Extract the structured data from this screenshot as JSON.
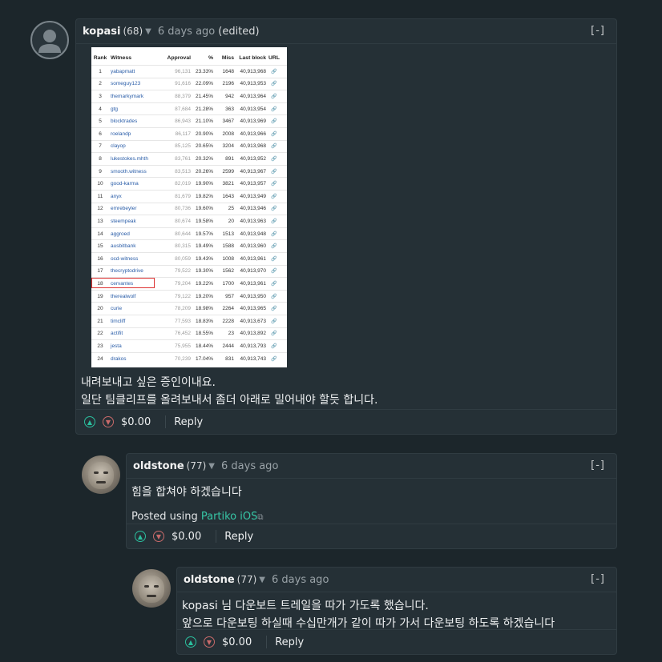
{
  "comments": [
    {
      "author": "kopasi",
      "reputation": "(68)",
      "time": "6 days ago",
      "edited": "(edited)",
      "collapse": "[-]",
      "lines": [
        "내려보내고 싶은 증인이내요.",
        "일단 팀클리프를 올려보내서 좀더 아래로 밀어내야 할듯 합니다."
      ],
      "payout": "$0.00",
      "reply": "Reply"
    },
    {
      "author": "oldstone",
      "reputation": "(77)",
      "time": "6 days ago",
      "collapse": "[-]",
      "lines": [
        "힘을 합쳐야 하겠습니다"
      ],
      "posted_prefix": "Posted using ",
      "posted_link": "Partiko iOS",
      "payout": "$0.00",
      "reply": "Reply"
    },
    {
      "author": "oldstone",
      "reputation": "(77)",
      "time": "6 days ago",
      "collapse": "[-]",
      "lines": [
        "kopasi 님 다운보트 트레일을 따가 가도록 했습니다.",
        "앞으로 다운보팅 하실때 수십만개가 같이 따가 가서 다운보팅 하도록 하겠습니다"
      ],
      "payout": "$0.00",
      "reply": "Reply"
    }
  ],
  "witness_table": {
    "headers": [
      "Rank",
      "Witness",
      "Approval",
      "%",
      "Miss",
      "Last block",
      "URL"
    ],
    "rows": [
      [
        "1",
        "yabapmatt",
        "96,131",
        "23.33%",
        "1648",
        "40,913,968"
      ],
      [
        "2",
        "someguy123",
        "91,616",
        "22.09%",
        "2196",
        "40,913,953"
      ],
      [
        "3",
        "themarkymark",
        "88,379",
        "21.45%",
        "942",
        "40,913,964"
      ],
      [
        "4",
        "gtg",
        "87,684",
        "21.28%",
        "363",
        "40,913,954"
      ],
      [
        "5",
        "blocktrades",
        "86,943",
        "21.10%",
        "3467",
        "40,913,969"
      ],
      [
        "6",
        "roelandp",
        "86,117",
        "20.90%",
        "2008",
        "40,913,966"
      ],
      [
        "7",
        "clayop",
        "85,125",
        "20.65%",
        "3204",
        "40,913,968"
      ],
      [
        "8",
        "lukestokes.mhth",
        "83,761",
        "20.32%",
        "891",
        "40,913,952"
      ],
      [
        "9",
        "smooth.witness",
        "83,513",
        "20.26%",
        "2599",
        "40,913,967"
      ],
      [
        "10",
        "good-karma",
        "82,019",
        "19.90%",
        "3821",
        "40,913,957"
      ],
      [
        "11",
        "anyx",
        "81,679",
        "19.82%",
        "1643",
        "40,913,949"
      ],
      [
        "12",
        "emrebeyler",
        "80,736",
        "19.60%",
        "25",
        "40,913,946"
      ],
      [
        "13",
        "steempeak",
        "80,674",
        "19.58%",
        "20",
        "40,913,963"
      ],
      [
        "14",
        "aggroed",
        "80,644",
        "19.57%",
        "1513",
        "40,913,948"
      ],
      [
        "15",
        "ausbitbank",
        "80,315",
        "19.49%",
        "1588",
        "40,913,960"
      ],
      [
        "16",
        "ocd-witness",
        "80,059",
        "19.43%",
        "1008",
        "40,913,961"
      ],
      [
        "17",
        "thecryptodrive",
        "79,522",
        "19.30%",
        "1562",
        "40,913,970"
      ],
      [
        "18",
        "cervantes",
        "79,204",
        "19.22%",
        "1700",
        "40,913,961"
      ],
      [
        "19",
        "therealwolf",
        "79,122",
        "19.20%",
        "957",
        "40,913,950"
      ],
      [
        "20",
        "curie",
        "78,209",
        "18.98%",
        "2264",
        "40,913,965"
      ],
      [
        "21",
        "timcliff",
        "77,593",
        "18.83%",
        "2228",
        "40,913,673"
      ],
      [
        "22",
        "actifit",
        "76,452",
        "18.55%",
        "23",
        "40,913,892"
      ],
      [
        "23",
        "jesta",
        "75,955",
        "18.44%",
        "2444",
        "40,913,793"
      ],
      [
        "24",
        "drakos",
        "70,239",
        "17.04%",
        "831",
        "40,913,743"
      ]
    ],
    "highlighted_rank": "18",
    "link_glyph": "🔗"
  }
}
